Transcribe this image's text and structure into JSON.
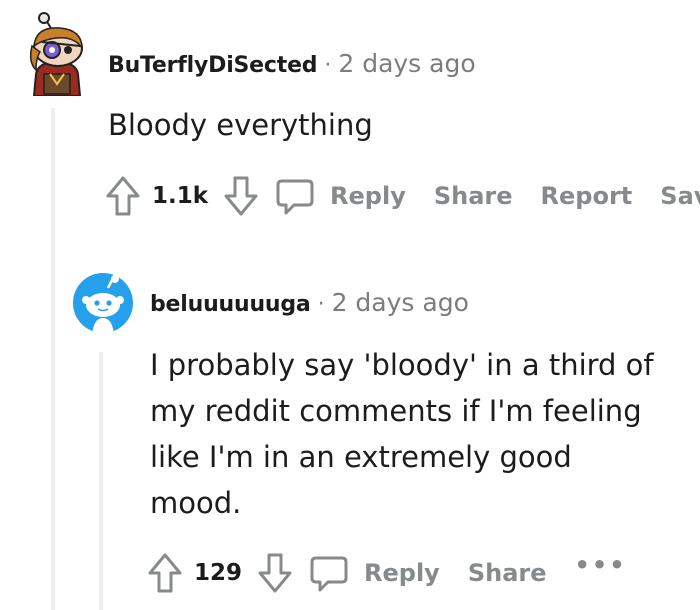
{
  "comments": [
    {
      "username": "BuTerflyDiSected",
      "separator": "·",
      "timestamp": "2 days ago",
      "body": "Bloody everything",
      "score": "1.1k",
      "actions": [
        "Reply",
        "Share",
        "Report",
        "Save"
      ]
    },
    {
      "username": "beluuuuuuga",
      "separator": "·",
      "timestamp": "2 days ago",
      "body": "I probably say 'bloody' in a third of my reddit comments if I'm feeling like I'm in an extremely good mood.",
      "score": "129",
      "actions": [
        "Reply",
        "Share"
      ],
      "more": "•••"
    }
  ],
  "colors": {
    "text": "#1c1c1c",
    "muted": "#7c7c7c",
    "action": "#878a8c",
    "thread_line": "#edeff1",
    "snoo_blue": "#24a0ed"
  },
  "icons": [
    "upvote-icon",
    "downvote-icon",
    "comment-bubble-icon",
    "more-dots-icon"
  ]
}
